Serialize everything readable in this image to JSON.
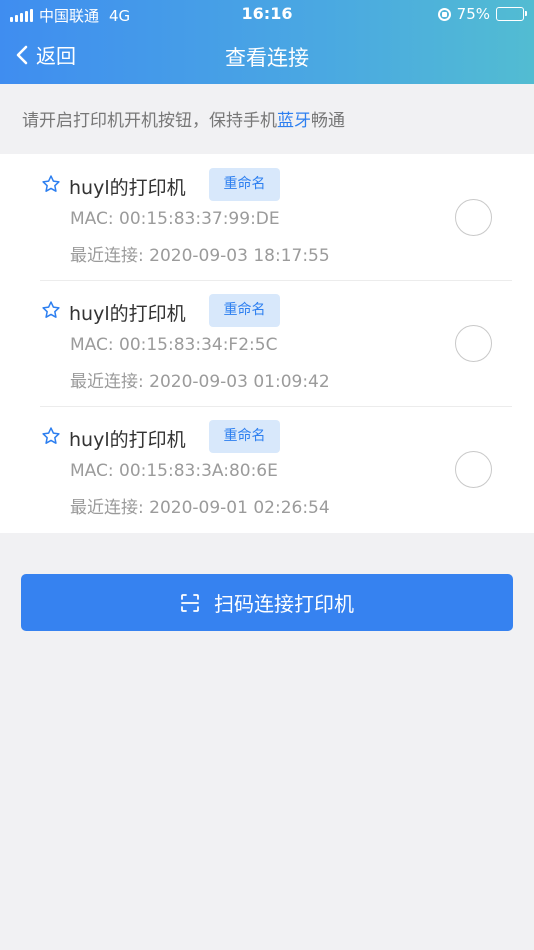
{
  "status_bar": {
    "carrier": "中国联通",
    "network": "4G",
    "time": "16:16",
    "battery": "75%",
    "battery_level": 0.75
  },
  "nav": {
    "back_label": "返回",
    "title": "查看连接"
  },
  "tip": {
    "before": "请开启打印机开机按钮，保持手机",
    "highlight": "蓝牙",
    "after": "畅通"
  },
  "printers": [
    {
      "name": "huyl的打印机",
      "rename_label": "重命名",
      "mac": "MAC: 00:15:83:37:99:DE",
      "last_connect": "最近连接: 2020-09-03 18:17:55"
    },
    {
      "name": "huyl的打印机",
      "rename_label": "重命名",
      "mac": "MAC: 00:15:83:34:F2:5C",
      "last_connect": "最近连接: 2020-09-03 01:09:42"
    },
    {
      "name": "huyl的打印机",
      "rename_label": "重命名",
      "mac": "MAC: 00:15:83:3A:80:6E",
      "last_connect": "最近连接: 2020-09-01 02:26:54"
    }
  ],
  "scan_button": {
    "label": "扫码连接打印机"
  },
  "colors": {
    "accent": "#3682f0",
    "rename_bg": "#d8e8fb"
  }
}
